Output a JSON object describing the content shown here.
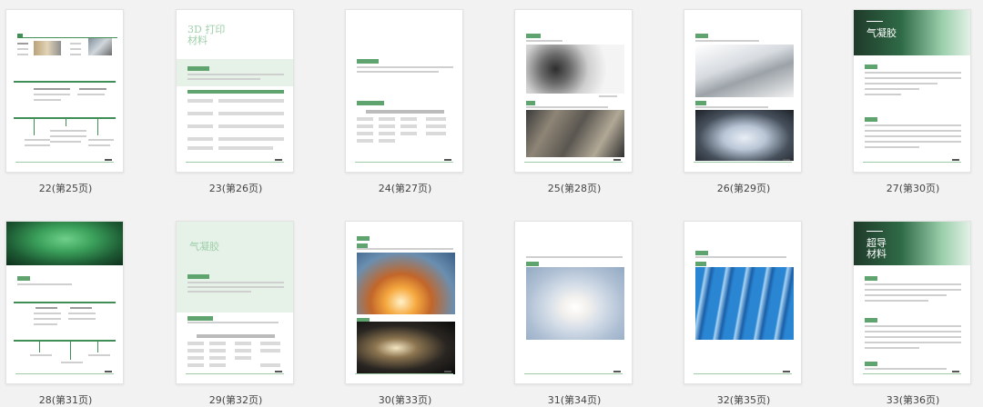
{
  "pages": [
    {
      "id": "p22",
      "caption": "22(第25页)"
    },
    {
      "id": "p23",
      "caption": "23(第26页)",
      "title": "3D 打印\n材料"
    },
    {
      "id": "p24",
      "caption": "24(第27页)"
    },
    {
      "id": "p25",
      "caption": "25(第28页)"
    },
    {
      "id": "p26",
      "caption": "26(第29页)"
    },
    {
      "id": "p27",
      "caption": "27(第30页)",
      "title": "气凝胶"
    },
    {
      "id": "p28",
      "caption": "28(第31页)"
    },
    {
      "id": "p29",
      "caption": "29(第32页)",
      "title": "气凝胶"
    },
    {
      "id": "p30",
      "caption": "30(第33页)"
    },
    {
      "id": "p31",
      "caption": "31(第34页)"
    },
    {
      "id": "p32",
      "caption": "32(第35页)"
    },
    {
      "id": "p33",
      "caption": "33(第36页)",
      "title": "超导\n材料"
    }
  ],
  "colors": {
    "accent": "#3f8f57",
    "light_accent": "#e6f1e8",
    "title_light": "#9fcfaa"
  }
}
